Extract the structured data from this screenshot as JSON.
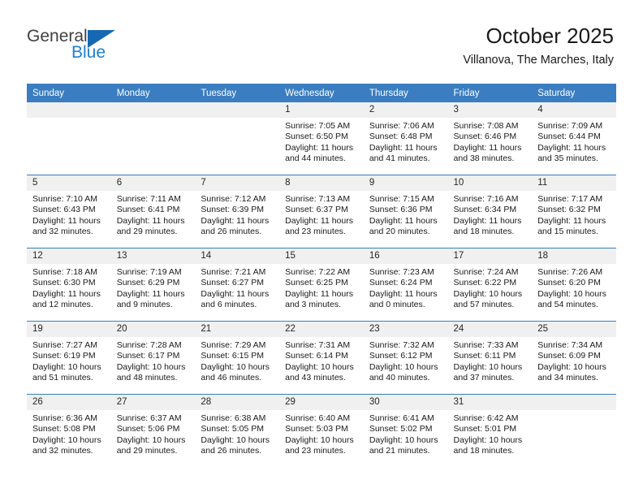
{
  "brand": {
    "name_part1": "General",
    "name_part2": "Blue",
    "triangle_icon": "triangle-logo-icon",
    "colors": {
      "text": "#404040",
      "accent": "#1f7fd0",
      "triangle": "#1668b3"
    }
  },
  "header": {
    "title": "October 2025",
    "subtitle": "Villanova, The Marches, Italy"
  },
  "theme": {
    "header_row_bg": "#3a7dc0",
    "daynum_bg": "#f0f0f0",
    "grid_line": "#3a7dc0"
  },
  "weekday_headers": [
    "Sunday",
    "Monday",
    "Tuesday",
    "Wednesday",
    "Thursday",
    "Friday",
    "Saturday"
  ],
  "weeks": [
    [
      {
        "empty": true,
        "day": "",
        "sunrise": "",
        "sunset": "",
        "daylight1": "",
        "daylight2": ""
      },
      {
        "empty": true,
        "day": "",
        "sunrise": "",
        "sunset": "",
        "daylight1": "",
        "daylight2": ""
      },
      {
        "empty": true,
        "day": "",
        "sunrise": "",
        "sunset": "",
        "daylight1": "",
        "daylight2": ""
      },
      {
        "empty": false,
        "day": "1",
        "sunrise": "Sunrise: 7:05 AM",
        "sunset": "Sunset: 6:50 PM",
        "daylight1": "Daylight: 11 hours",
        "daylight2": "and 44 minutes."
      },
      {
        "empty": false,
        "day": "2",
        "sunrise": "Sunrise: 7:06 AM",
        "sunset": "Sunset: 6:48 PM",
        "daylight1": "Daylight: 11 hours",
        "daylight2": "and 41 minutes."
      },
      {
        "empty": false,
        "day": "3",
        "sunrise": "Sunrise: 7:08 AM",
        "sunset": "Sunset: 6:46 PM",
        "daylight1": "Daylight: 11 hours",
        "daylight2": "and 38 minutes."
      },
      {
        "empty": false,
        "day": "4",
        "sunrise": "Sunrise: 7:09 AM",
        "sunset": "Sunset: 6:44 PM",
        "daylight1": "Daylight: 11 hours",
        "daylight2": "and 35 minutes."
      }
    ],
    [
      {
        "empty": false,
        "day": "5",
        "sunrise": "Sunrise: 7:10 AM",
        "sunset": "Sunset: 6:43 PM",
        "daylight1": "Daylight: 11 hours",
        "daylight2": "and 32 minutes."
      },
      {
        "empty": false,
        "day": "6",
        "sunrise": "Sunrise: 7:11 AM",
        "sunset": "Sunset: 6:41 PM",
        "daylight1": "Daylight: 11 hours",
        "daylight2": "and 29 minutes."
      },
      {
        "empty": false,
        "day": "7",
        "sunrise": "Sunrise: 7:12 AM",
        "sunset": "Sunset: 6:39 PM",
        "daylight1": "Daylight: 11 hours",
        "daylight2": "and 26 minutes."
      },
      {
        "empty": false,
        "day": "8",
        "sunrise": "Sunrise: 7:13 AM",
        "sunset": "Sunset: 6:37 PM",
        "daylight1": "Daylight: 11 hours",
        "daylight2": "and 23 minutes."
      },
      {
        "empty": false,
        "day": "9",
        "sunrise": "Sunrise: 7:15 AM",
        "sunset": "Sunset: 6:36 PM",
        "daylight1": "Daylight: 11 hours",
        "daylight2": "and 20 minutes."
      },
      {
        "empty": false,
        "day": "10",
        "sunrise": "Sunrise: 7:16 AM",
        "sunset": "Sunset: 6:34 PM",
        "daylight1": "Daylight: 11 hours",
        "daylight2": "and 18 minutes."
      },
      {
        "empty": false,
        "day": "11",
        "sunrise": "Sunrise: 7:17 AM",
        "sunset": "Sunset: 6:32 PM",
        "daylight1": "Daylight: 11 hours",
        "daylight2": "and 15 minutes."
      }
    ],
    [
      {
        "empty": false,
        "day": "12",
        "sunrise": "Sunrise: 7:18 AM",
        "sunset": "Sunset: 6:30 PM",
        "daylight1": "Daylight: 11 hours",
        "daylight2": "and 12 minutes."
      },
      {
        "empty": false,
        "day": "13",
        "sunrise": "Sunrise: 7:19 AM",
        "sunset": "Sunset: 6:29 PM",
        "daylight1": "Daylight: 11 hours",
        "daylight2": "and 9 minutes."
      },
      {
        "empty": false,
        "day": "14",
        "sunrise": "Sunrise: 7:21 AM",
        "sunset": "Sunset: 6:27 PM",
        "daylight1": "Daylight: 11 hours",
        "daylight2": "and 6 minutes."
      },
      {
        "empty": false,
        "day": "15",
        "sunrise": "Sunrise: 7:22 AM",
        "sunset": "Sunset: 6:25 PM",
        "daylight1": "Daylight: 11 hours",
        "daylight2": "and 3 minutes."
      },
      {
        "empty": false,
        "day": "16",
        "sunrise": "Sunrise: 7:23 AM",
        "sunset": "Sunset: 6:24 PM",
        "daylight1": "Daylight: 11 hours",
        "daylight2": "and 0 minutes."
      },
      {
        "empty": false,
        "day": "17",
        "sunrise": "Sunrise: 7:24 AM",
        "sunset": "Sunset: 6:22 PM",
        "daylight1": "Daylight: 10 hours",
        "daylight2": "and 57 minutes."
      },
      {
        "empty": false,
        "day": "18",
        "sunrise": "Sunrise: 7:26 AM",
        "sunset": "Sunset: 6:20 PM",
        "daylight1": "Daylight: 10 hours",
        "daylight2": "and 54 minutes."
      }
    ],
    [
      {
        "empty": false,
        "day": "19",
        "sunrise": "Sunrise: 7:27 AM",
        "sunset": "Sunset: 6:19 PM",
        "daylight1": "Daylight: 10 hours",
        "daylight2": "and 51 minutes."
      },
      {
        "empty": false,
        "day": "20",
        "sunrise": "Sunrise: 7:28 AM",
        "sunset": "Sunset: 6:17 PM",
        "daylight1": "Daylight: 10 hours",
        "daylight2": "and 48 minutes."
      },
      {
        "empty": false,
        "day": "21",
        "sunrise": "Sunrise: 7:29 AM",
        "sunset": "Sunset: 6:15 PM",
        "daylight1": "Daylight: 10 hours",
        "daylight2": "and 46 minutes."
      },
      {
        "empty": false,
        "day": "22",
        "sunrise": "Sunrise: 7:31 AM",
        "sunset": "Sunset: 6:14 PM",
        "daylight1": "Daylight: 10 hours",
        "daylight2": "and 43 minutes."
      },
      {
        "empty": false,
        "day": "23",
        "sunrise": "Sunrise: 7:32 AM",
        "sunset": "Sunset: 6:12 PM",
        "daylight1": "Daylight: 10 hours",
        "daylight2": "and 40 minutes."
      },
      {
        "empty": false,
        "day": "24",
        "sunrise": "Sunrise: 7:33 AM",
        "sunset": "Sunset: 6:11 PM",
        "daylight1": "Daylight: 10 hours",
        "daylight2": "and 37 minutes."
      },
      {
        "empty": false,
        "day": "25",
        "sunrise": "Sunrise: 7:34 AM",
        "sunset": "Sunset: 6:09 PM",
        "daylight1": "Daylight: 10 hours",
        "daylight2": "and 34 minutes."
      }
    ],
    [
      {
        "empty": false,
        "day": "26",
        "sunrise": "Sunrise: 6:36 AM",
        "sunset": "Sunset: 5:08 PM",
        "daylight1": "Daylight: 10 hours",
        "daylight2": "and 32 minutes."
      },
      {
        "empty": false,
        "day": "27",
        "sunrise": "Sunrise: 6:37 AM",
        "sunset": "Sunset: 5:06 PM",
        "daylight1": "Daylight: 10 hours",
        "daylight2": "and 29 minutes."
      },
      {
        "empty": false,
        "day": "28",
        "sunrise": "Sunrise: 6:38 AM",
        "sunset": "Sunset: 5:05 PM",
        "daylight1": "Daylight: 10 hours",
        "daylight2": "and 26 minutes."
      },
      {
        "empty": false,
        "day": "29",
        "sunrise": "Sunrise: 6:40 AM",
        "sunset": "Sunset: 5:03 PM",
        "daylight1": "Daylight: 10 hours",
        "daylight2": "and 23 minutes."
      },
      {
        "empty": false,
        "day": "30",
        "sunrise": "Sunrise: 6:41 AM",
        "sunset": "Sunset: 5:02 PM",
        "daylight1": "Daylight: 10 hours",
        "daylight2": "and 21 minutes."
      },
      {
        "empty": false,
        "day": "31",
        "sunrise": "Sunrise: 6:42 AM",
        "sunset": "Sunset: 5:01 PM",
        "daylight1": "Daylight: 10 hours",
        "daylight2": "and 18 minutes."
      },
      {
        "empty": true,
        "day": "",
        "sunrise": "",
        "sunset": "",
        "daylight1": "",
        "daylight2": ""
      }
    ]
  ]
}
